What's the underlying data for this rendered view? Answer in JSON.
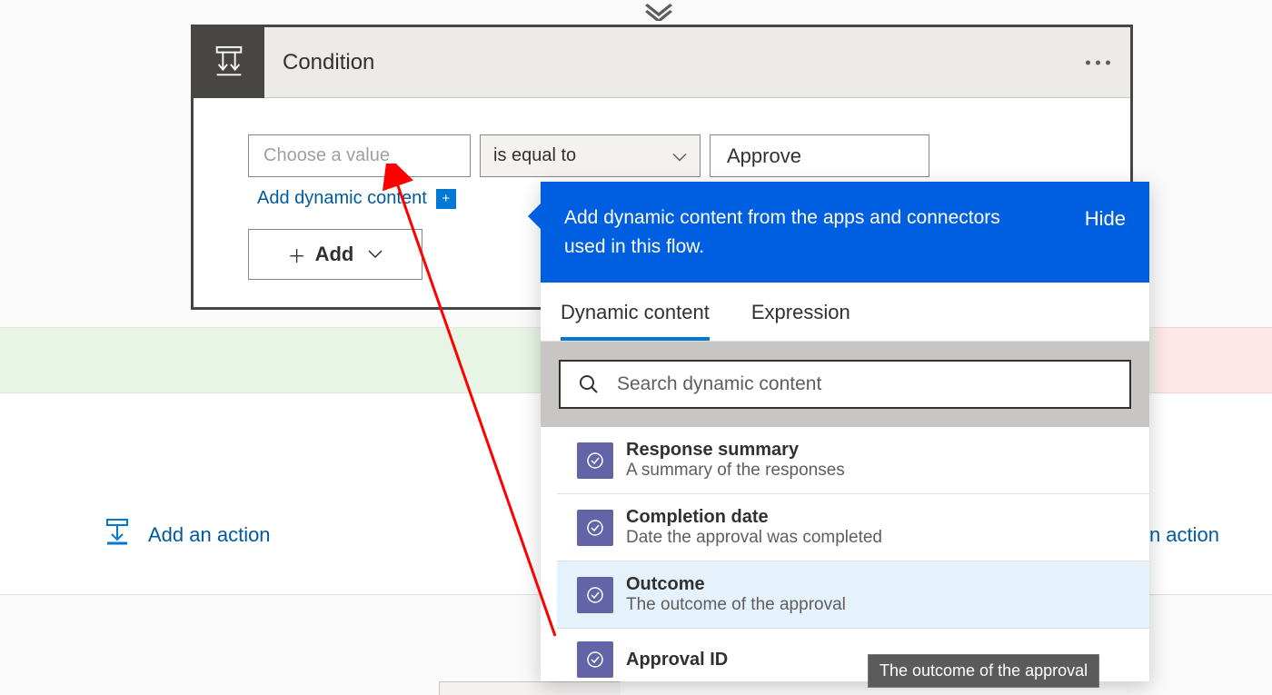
{
  "connector_arrow": "⇓",
  "condition": {
    "title": "Condition",
    "value_placeholder": "Choose a value",
    "operator": "is equal to",
    "compare_value": "Approve",
    "add_dynamic_link": "Add dynamic content",
    "add_button": "Add"
  },
  "add_action_left": "Add an action",
  "add_action_right": "an action",
  "popover": {
    "message": "Add dynamic content from the apps and connectors used in this flow.",
    "hide": "Hide",
    "tabs": {
      "dynamic": "Dynamic content",
      "expression": "Expression"
    },
    "search_placeholder": "Search dynamic content",
    "items": [
      {
        "title": "Response summary",
        "desc": "A summary of the responses"
      },
      {
        "title": "Completion date",
        "desc": "Date the approval was completed"
      },
      {
        "title": "Outcome",
        "desc": "The outcome of the approval"
      },
      {
        "title": "Approval ID",
        "desc": ""
      }
    ]
  },
  "tooltip": "The outcome of the approval"
}
